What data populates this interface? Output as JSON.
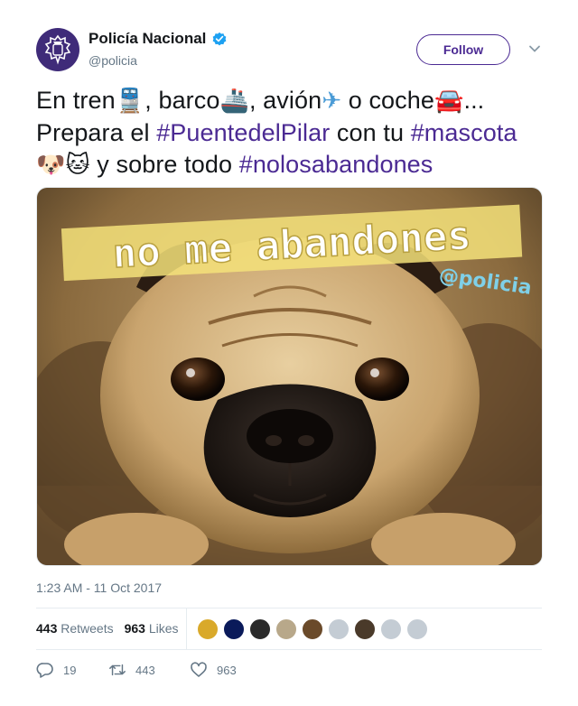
{
  "account": {
    "name": "Policía Nacional",
    "handle": "@policia",
    "follow_label": "Follow"
  },
  "tweet": {
    "line1_a": "En tren",
    "line1_b": ", barco",
    "line1_c": ", avión",
    "line1_d": " o coche",
    "line1_e": "...",
    "line2_a": "Prepara el ",
    "hashtag1": "#PuentedelPilar",
    "line2_b": " con tu ",
    "hashtag2": "#mascota",
    "line3_a": " y sobre todo ",
    "hashtag3": "#nolosabandones"
  },
  "emojis": {
    "train": "🚆",
    "ship": "🚢",
    "plane": "✈",
    "car": "🚘",
    "dog": "🐶",
    "cat": "🐱"
  },
  "media": {
    "overlay_text": "no me abandones",
    "watermark": "@policia"
  },
  "timestamp": "1:23 AM - 11 Oct 2017",
  "stats": {
    "retweets_count": "443",
    "retweets_label": "Retweets",
    "likes_count": "963",
    "likes_label": "Likes"
  },
  "actions": {
    "replies": "19",
    "retweets": "443",
    "likes": "963"
  },
  "colors": {
    "brand": "#4b2a93",
    "text": "#14171a",
    "muted": "#657786",
    "verified": "#1da1f2"
  }
}
